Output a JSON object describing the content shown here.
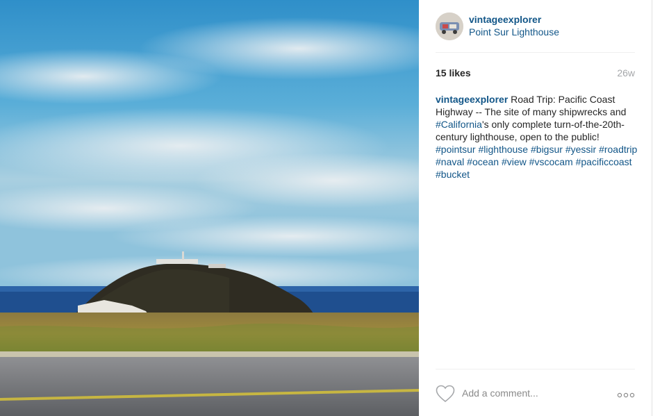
{
  "post": {
    "username": "vintageexplorer",
    "location": "Point Sur Lighthouse",
    "likes": "15 likes",
    "age": "26w"
  },
  "caption": {
    "username": "vintageexplorer",
    "text_1": " Road Trip: Pacific Coast Highway -- The site of many shipwrecks and ",
    "tag_california": "#California",
    "text_2": "'s only complete turn-of-the-20th-century lighthouse, open to the public! ",
    "tags": [
      "#pointsur",
      "#lighthouse",
      "#bigsur",
      "#yessir",
      "#roadtrip",
      "#naval",
      "#ocean",
      "#view",
      "#vscocam",
      "#pacificcoast",
      "#bucket"
    ]
  },
  "comment": {
    "placeholder": "Add a comment..."
  },
  "icons": {
    "like": "heart-icon",
    "options": "more-options-icon"
  },
  "colors": {
    "link": "#125688",
    "muted": "#a5a7aa",
    "divider": "#efefef"
  }
}
